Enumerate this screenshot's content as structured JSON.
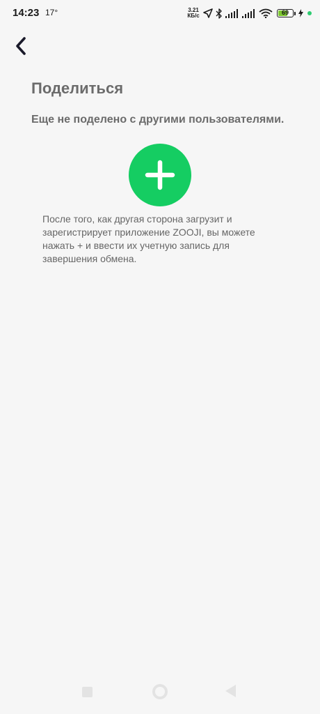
{
  "status_bar": {
    "time": "14:23",
    "temperature": "17°",
    "net_speed_value": "3.21",
    "net_speed_unit": "КБ/с",
    "battery_level": 69,
    "battery_text": "69",
    "battery_color": "#7cc62f"
  },
  "header": {
    "back_icon": "chevron-left-icon",
    "title": "Поделиться"
  },
  "content": {
    "empty_message": "Еще не поделено с другими пользователями.",
    "add_icon": "plus-icon",
    "add_button_color": "#15cd62",
    "info_text": "После того, как другая сторона загрузит и зарегистрирует приложение ZOOJI, вы можете нажать + и ввести их учетную запись для завершения обмена."
  },
  "navigation_bar": {
    "recents_icon": "square-icon",
    "home_icon": "circle-icon",
    "back_icon": "triangle-back-icon"
  }
}
